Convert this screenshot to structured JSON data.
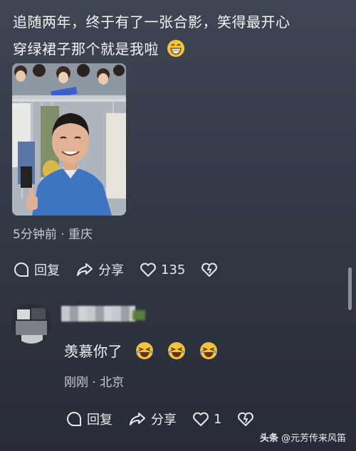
{
  "post": {
    "line1": "追随两年，终于有了一张合影，笑得最开心",
    "line2": "穿绿裙子那个就是我啦",
    "meta": "5分钟前 · 重庆",
    "reply_label": "回复",
    "share_label": "分享",
    "like_count": "135"
  },
  "comment": {
    "text": "羡慕你了",
    "meta": "刚刚 · 北京",
    "reply_label": "回复",
    "share_label": "分享",
    "like_count": "1"
  },
  "watermark": {
    "brand": "头条",
    "handle": "@元芳传来风笛"
  },
  "colors": {
    "background_top": "#3f4552",
    "background_bottom": "#272c37",
    "text": "#f4f5f8",
    "meta_text": "#c6cad2",
    "emoji_yellow": "#f6c33a",
    "emoji_tear": "#39a3ef"
  },
  "icons": [
    "grin-emoji",
    "comment-icon",
    "share-icon",
    "heart-icon",
    "broken-heart-icon",
    "laughing-tears-emoji"
  ]
}
